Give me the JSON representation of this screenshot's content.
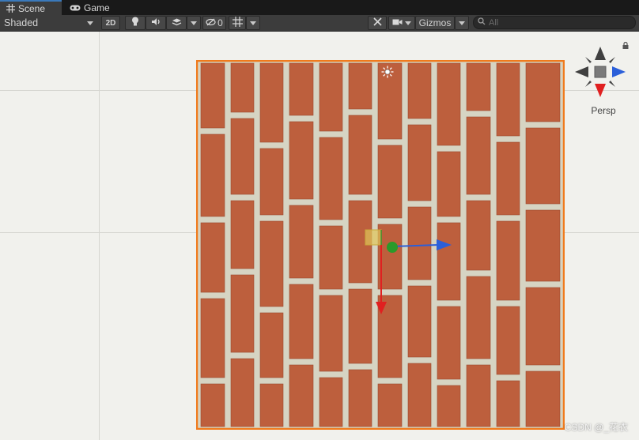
{
  "tabs": [
    {
      "label": "Scene",
      "icon": "grid-icon",
      "active": true
    },
    {
      "label": "Game",
      "icon": "gamepad-icon",
      "active": false
    }
  ],
  "toolbar": {
    "shading_mode": "Shaded",
    "toggle_2d": "2D",
    "hidden_count": "0",
    "gizmos_label": "Gizmos",
    "search_placeholder": "All"
  },
  "scene": {
    "projection_label": "Persp",
    "watermark": "CSDN @_花衣"
  },
  "colors": {
    "brick": "#c0613e",
    "mortar": "#d9d7c5",
    "selection_outline": "#f07a1c",
    "axis_x": "#e02020",
    "axis_y": "#2a9a2a",
    "axis_z": "#2b5fd9"
  }
}
